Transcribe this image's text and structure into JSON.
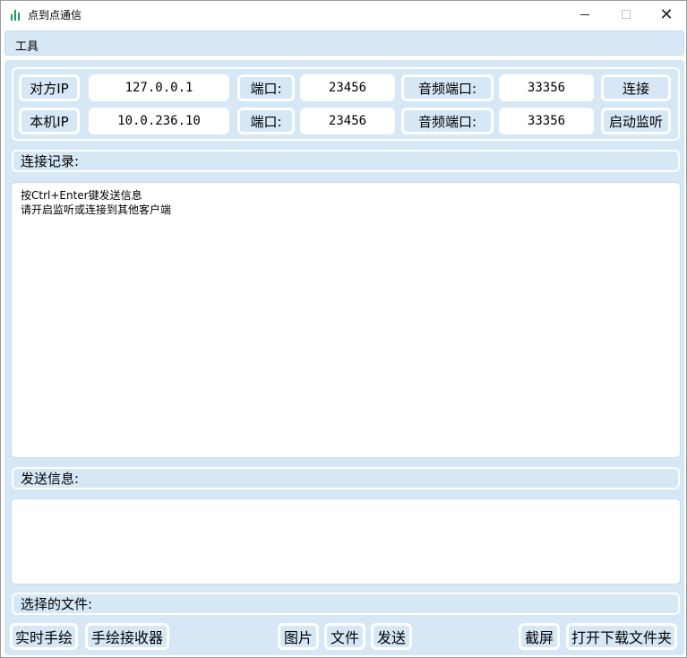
{
  "window": {
    "title": "点到点通信"
  },
  "menu": {
    "tools_label": "工具"
  },
  "remote": {
    "label": "对方IP",
    "ip": "127.0.0.1",
    "port_label": "端口:",
    "port": "23456",
    "audio_port_label": "音频端口:",
    "audio_port": "33356",
    "connect_label": "连接"
  },
  "local": {
    "label": "本机IP",
    "ip": "10.0.236.10",
    "port_label": "端口:",
    "port": "23456",
    "audio_port_label": "音频端口:",
    "audio_port": "33356",
    "listen_label": "启动监听"
  },
  "log": {
    "header": "连接记录:",
    "lines": [
      "按Ctrl+Enter键发送信息",
      "请开启监听或连接到其他客户端"
    ]
  },
  "send": {
    "header": "发送信息:",
    "value": ""
  },
  "files": {
    "header": "选择的文件:"
  },
  "bottom": {
    "realtime_draw": "实时手绘",
    "draw_receiver": "手绘接收器",
    "image": "图片",
    "file": "文件",
    "send": "发送",
    "screenshot": "截屏",
    "open_download_folder": "打开下载文件夹"
  }
}
